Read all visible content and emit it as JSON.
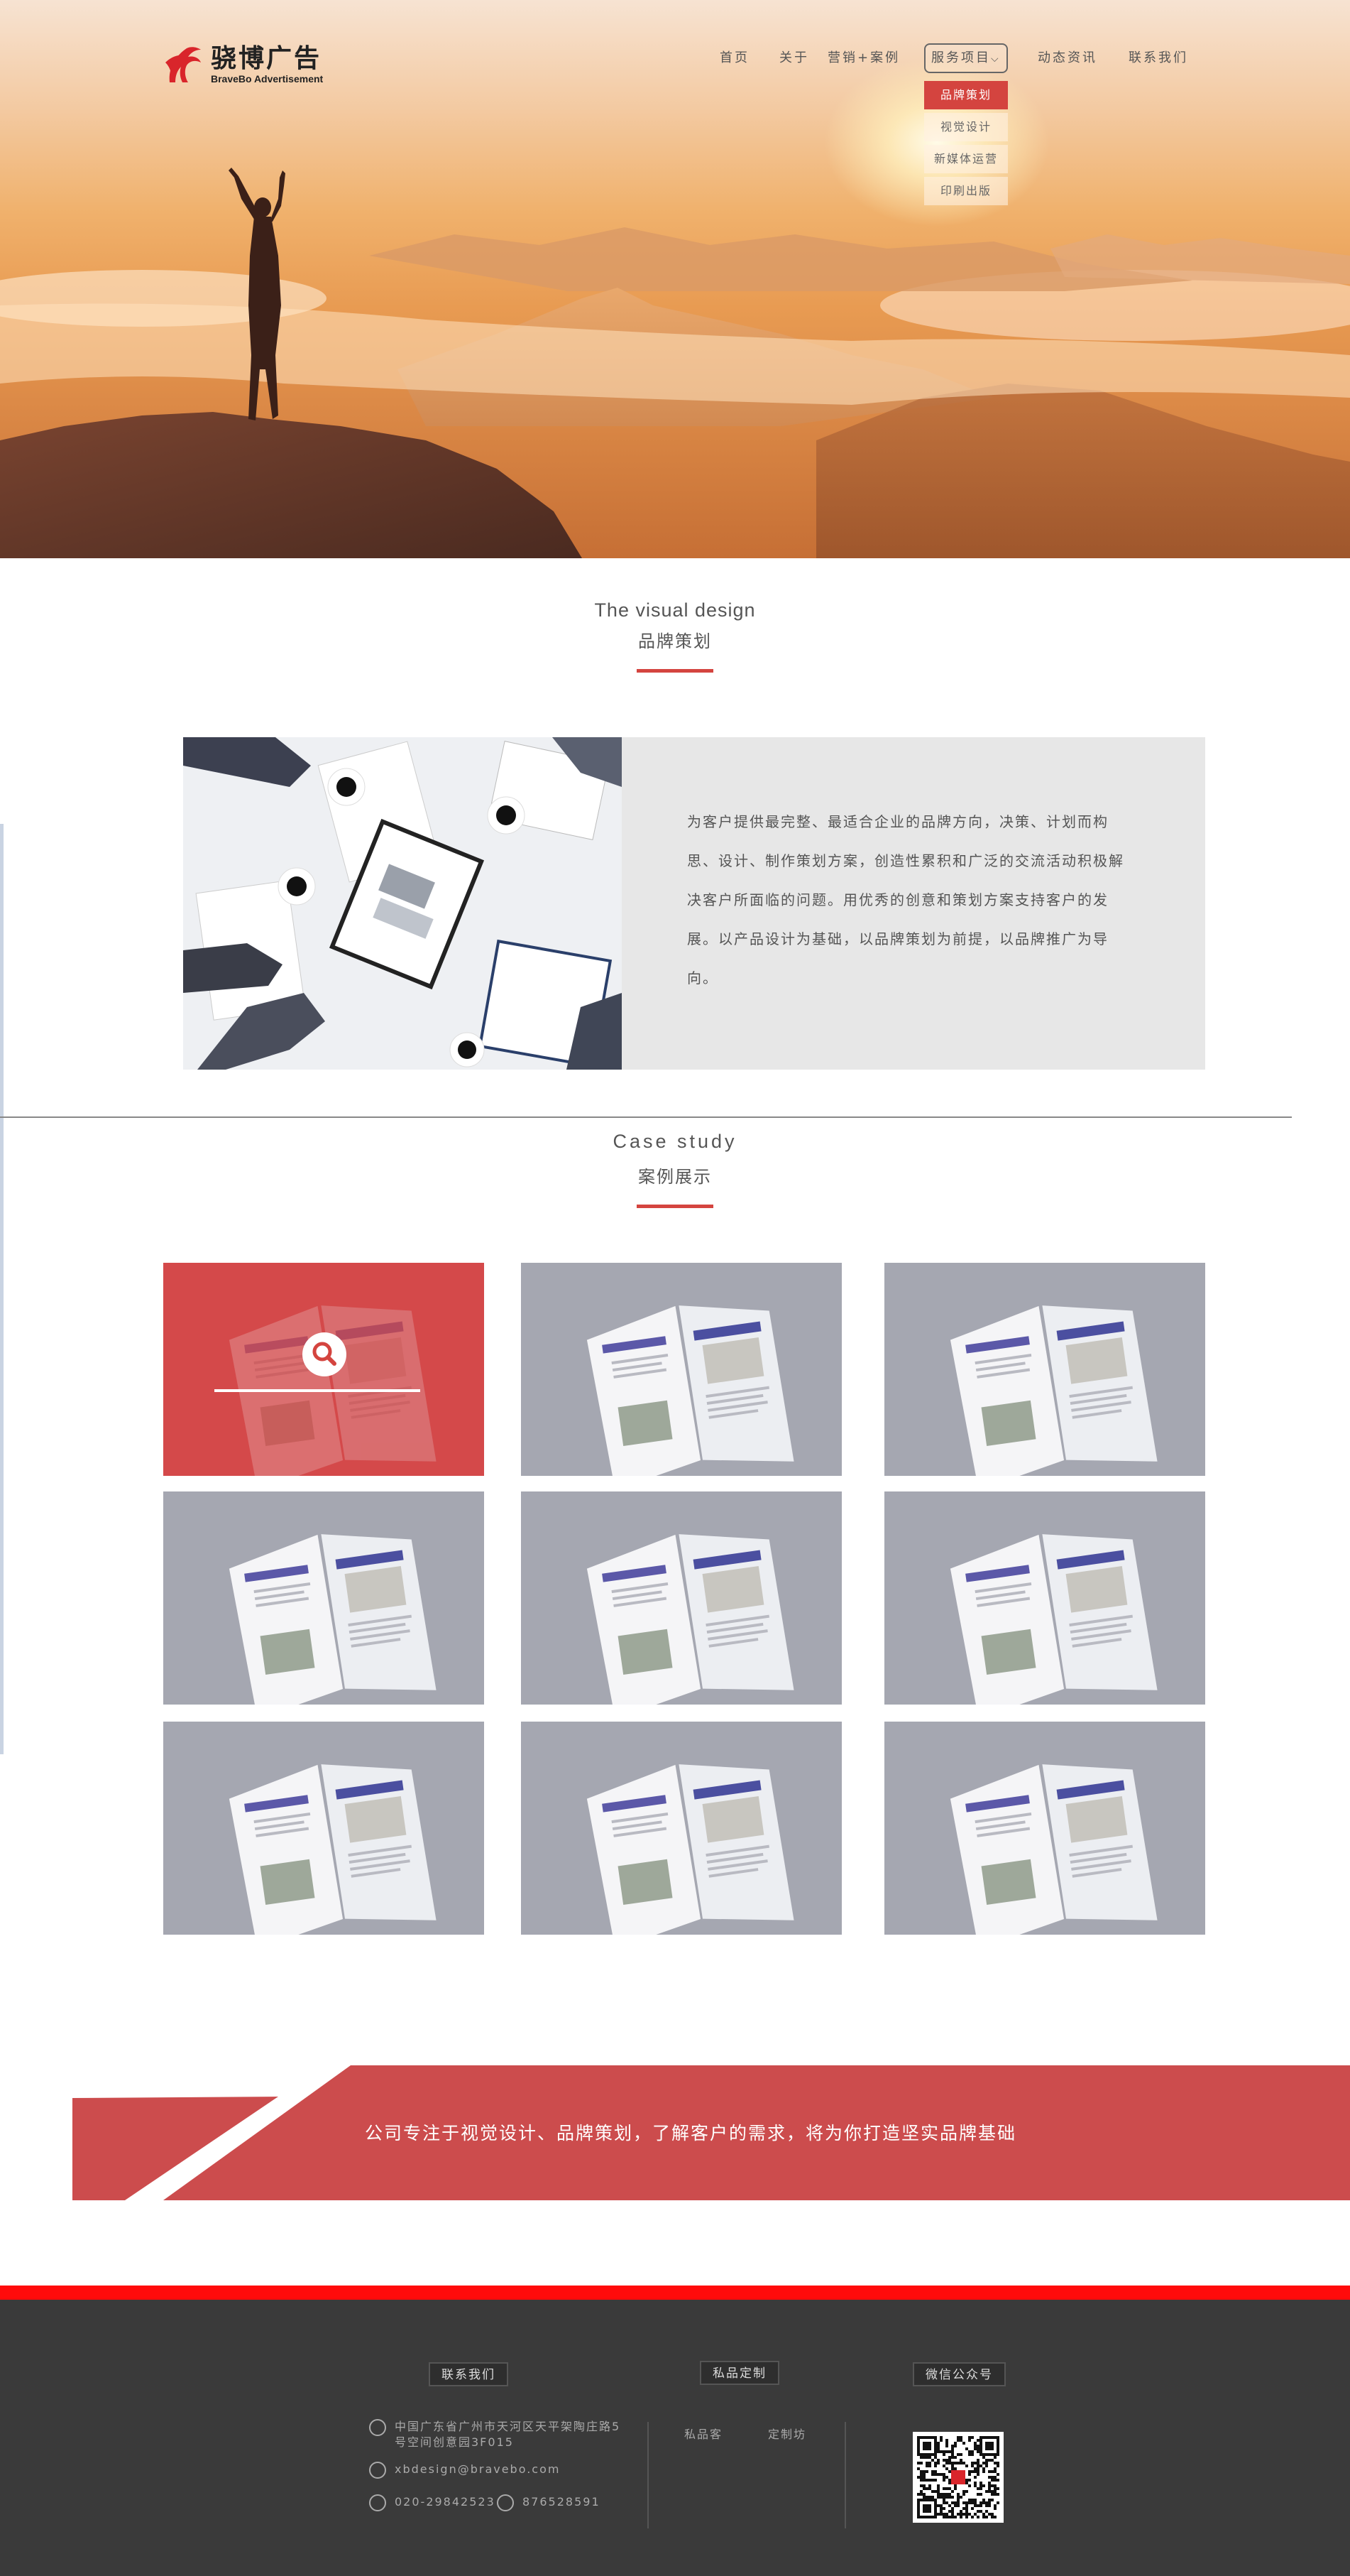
{
  "brand": {
    "name_cn": "骁博广告",
    "name_en": "BraveBo Advertisement"
  },
  "nav": {
    "items": [
      "首页",
      "关于",
      "营销+案例",
      "服务项目",
      "动态资讯",
      "联系我们"
    ],
    "dropdown": [
      "品牌策划",
      "视觉设计",
      "新媒体运营",
      "印刷出版"
    ]
  },
  "section1": {
    "title_en": "The visual design",
    "title_cn": "品牌策划",
    "body": "为客户提供最完整、最适合企业的品牌方向，决策、计划而构思、设计、制作策划方案，创造性累积和广泛的交流活动积极解决客户所面临的问题。用优秀的创意和策划方案支持客户的发展。以产品设计为基础，以品牌策划为前提，以品牌推广为导向。"
  },
  "section2": {
    "title_en": "Case study",
    "title_cn": "案例展示"
  },
  "banner": {
    "text": "公司专注于视觉设计、品牌策划，了解客户的需求，将为你打造坚实品牌基础"
  },
  "footer": {
    "contact_title": "联系我们",
    "address": "中国广东省广州市天河区天平架陶庄路5号空间创意园3F015",
    "email": "xbdesign@bravebo.com",
    "phone": "020-29842523",
    "qq": "876528591",
    "custom_title": "私品定制",
    "links": [
      "私品客",
      "定制坊"
    ],
    "wechat_title": "微信公众号"
  },
  "colors": {
    "accent": "#d4443f",
    "footer_bg": "#3a3a3a",
    "footer_red": "#ff0b0b"
  }
}
